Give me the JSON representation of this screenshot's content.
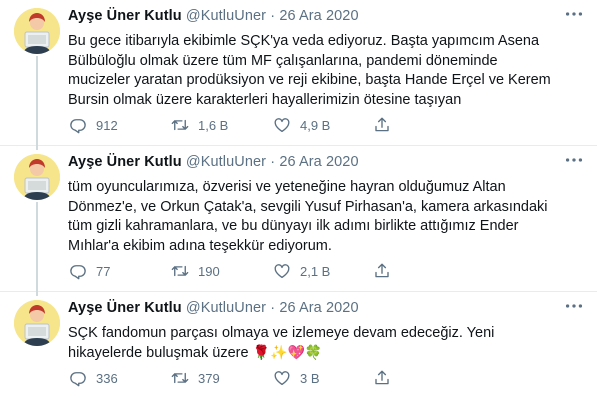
{
  "tweets": [
    {
      "author": {
        "name": "Ayşe Üner Kutlu",
        "handle": "@KutluUner"
      },
      "separator": "·",
      "date": "26 Ara 2020",
      "lines": [
        "Bu gece itibarıyla ekibimle SÇK'ya veda ediyoruz. Başta yapımcım Asena",
        "Bülbüloğlu olmak üzere tüm MF çalışanlarına, pandemi döneminde",
        "mucizeler yaratan prodüksiyon ve reji ekibine, başta Hande Erçel ve Kerem",
        "Bursin olmak üzere karakterleri hayallerimizin ötesine taşıyan"
      ],
      "stats": {
        "replies": "912",
        "retweets": "1,6 B",
        "likes": "4,9 B"
      }
    },
    {
      "author": {
        "name": "Ayşe Üner Kutlu",
        "handle": "@KutluUner"
      },
      "separator": "·",
      "date": "26 Ara 2020",
      "lines": [
        "tüm oyuncularımıza, özverisi ve yeteneğine hayran olduğumuz Altan",
        "Dönmez'e, ve Orkun Çatak'a, sevgili Yusuf Pirhasan'a, kamera arkasındaki",
        "tüm gizli kahramanlara, ve bu dünyayı ilk adımı birlikte attığımız Ender",
        "Mıhlar'a ekibim adına teşekkür ediyorum."
      ],
      "stats": {
        "replies": "77",
        "retweets": "190",
        "likes": "2,1 B"
      }
    },
    {
      "author": {
        "name": "Ayşe Üner Kutlu",
        "handle": "@KutluUner"
      },
      "separator": "·",
      "date": "26 Ara 2020",
      "lines": [
        "SÇK fandomun parçası olmaya ve izlemeye devam edeceğiz.  Yeni",
        "hikayelerde buluşmak üzere"
      ],
      "emojis": "🌹✨💖🍀",
      "stats": {
        "replies": "336",
        "retweets": "379",
        "likes": "3 B"
      }
    }
  ],
  "icons": {
    "reply": "reply-icon",
    "retweet": "retweet-icon",
    "like": "like-icon",
    "share": "share-icon",
    "more": "more-icon"
  },
  "colors": {
    "text": "#0f1419",
    "muted": "#5b7083",
    "divider": "#e6ecf0",
    "avatar_bg": "#f6e58a"
  }
}
